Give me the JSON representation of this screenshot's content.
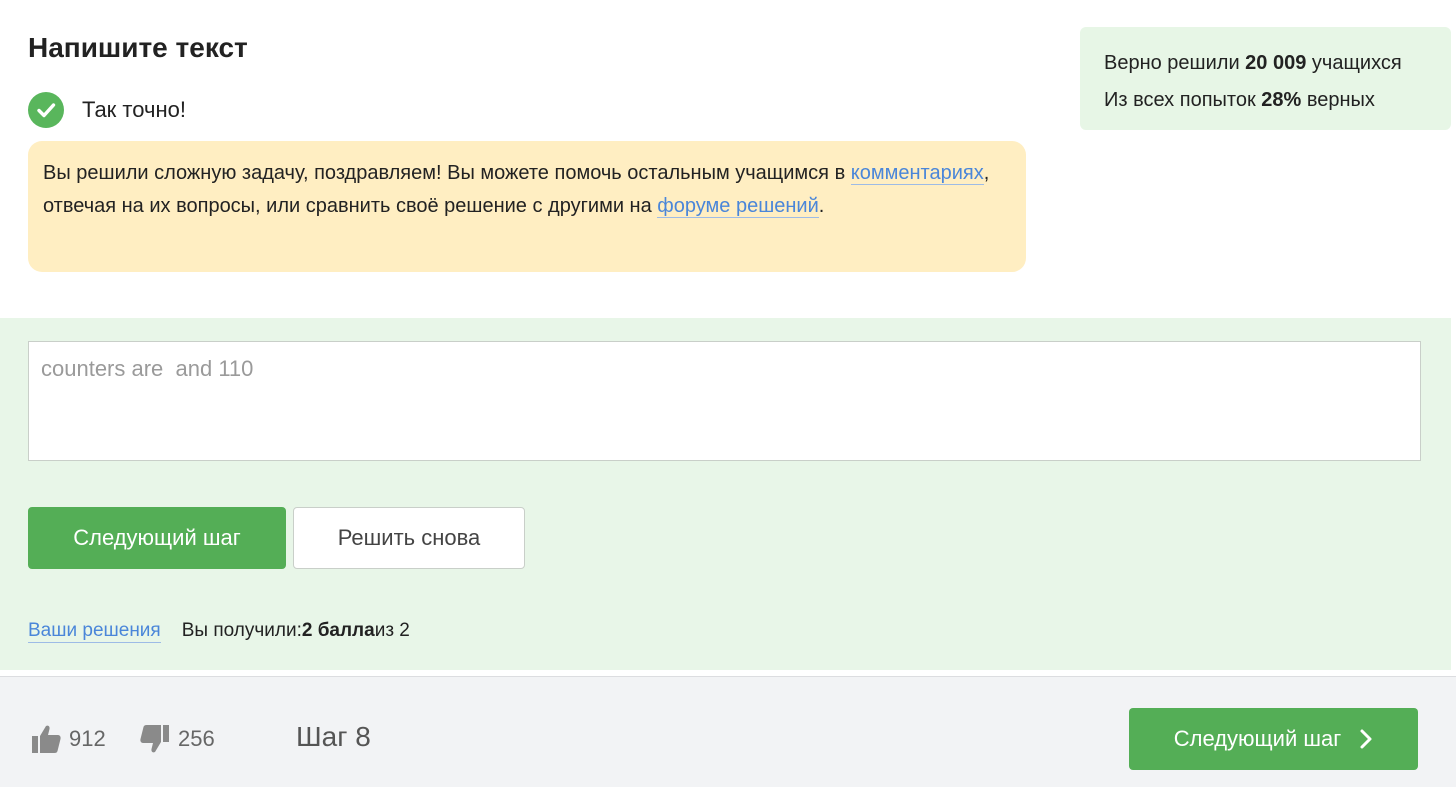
{
  "task": {
    "title": "Напишите текст"
  },
  "status": {
    "text": "Так точно!"
  },
  "congrats": {
    "text_before": "Вы решили сложную задачу, поздравляем! Вы можете помочь остальным учащимся в ",
    "comments_link": "комментариях",
    "text_middle": ", отвечая на их вопросы, или сравнить своё решение с другими на ",
    "forum_link": "форуме решений",
    "text_after": "."
  },
  "stats": {
    "solved_prefix": "Верно решили ",
    "solved_count": "20 009",
    "solved_suffix": " учащихся",
    "attempts_prefix": "Из всех попыток ",
    "attempts_percent": "28%",
    "attempts_suffix": " верных"
  },
  "answer": {
    "value": "counters are  and 110"
  },
  "buttons": {
    "next_step": "Следующий шаг",
    "retry": "Решить снова"
  },
  "result": {
    "solutions_link": "Ваши решения",
    "prefix": "Вы получили: ",
    "score": "2 балла",
    "suffix": " из 2"
  },
  "footer": {
    "likes": "912",
    "dislikes": "256",
    "step": "Шаг 8",
    "next_button": "Следующий шаг"
  },
  "colors": {
    "accent_green": "#54ae56",
    "success_bg": "#e8f6e8",
    "notice_bg": "#ffeec2",
    "link": "#4a86d9"
  },
  "icons": [
    "check-icon",
    "thumbs-up-icon",
    "thumbs-down-icon",
    "chevron-right-icon"
  ]
}
